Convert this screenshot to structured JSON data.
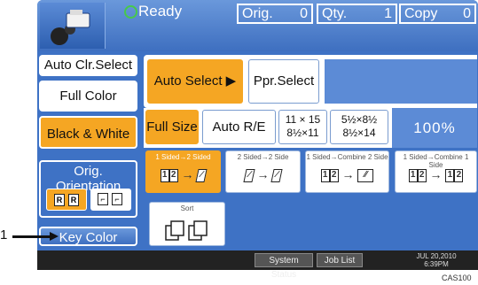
{
  "header": {
    "status": "Ready",
    "counters": [
      {
        "label": "Orig.",
        "value": "0"
      },
      {
        "label": "Qty.",
        "value": "1"
      },
      {
        "label": "Copy",
        "value": "0"
      }
    ]
  },
  "color_modes": {
    "auto": "Auto Clr.Select",
    "full": "Full Color",
    "bw": "Black & White"
  },
  "orientation": {
    "label": "Orig. Orientation"
  },
  "key_color": "Key Color",
  "paper": {
    "auto": "Auto Select ▶",
    "select": "Ppr.Select"
  },
  "reduce_enlarge": {
    "full_size": "Full Size",
    "auto": "Auto R/E",
    "preset1_top": "11 × 15",
    "preset1_bottom": "8½×11",
    "preset2_top": "5½×8½",
    "preset2_bottom": "8½×14",
    "ratio": "100%"
  },
  "duplex": [
    {
      "label": "1 Sided→2 Sided"
    },
    {
      "label": "2 Sided→2 Side"
    },
    {
      "label": "1 Sided→Combine 2 Side"
    },
    {
      "label": "1 Sided→Combine 1 Side"
    }
  ],
  "sort": {
    "label": "Sort"
  },
  "status_bar": {
    "system_status": "System Status",
    "job_list": "Job List",
    "date": "JUL  20,2010",
    "time": "6:39PM"
  },
  "callout": {
    "number": "1"
  },
  "figure_code": "CAS100",
  "colors": {
    "panel_blue": "#3e72c5",
    "selected_orange": "#f5a623",
    "ready_green": "#47c94b"
  }
}
